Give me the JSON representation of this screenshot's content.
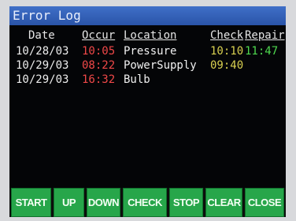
{
  "window": {
    "title": "Error Log"
  },
  "columns": {
    "date": "Date",
    "occur": "Occur",
    "location": "Location",
    "check": "Check",
    "repair": "Repair"
  },
  "rows": [
    {
      "date": "10/28/03",
      "occur": "10:05",
      "location": "Pressure",
      "check": "10:10",
      "repair": "11:47"
    },
    {
      "date": "10/29/03",
      "occur": "08:22",
      "location": "PowerSupply",
      "check": "09:40",
      "repair": ""
    },
    {
      "date": "10/29/03",
      "occur": "16:32",
      "location": "Bulb",
      "check": "",
      "repair": ""
    }
  ],
  "buttons": {
    "start": "START",
    "up": "UP",
    "down": "DOWN",
    "check": "CHECK",
    "stop": "STOP",
    "clear": "CLEAR",
    "close": "CLOSE"
  },
  "colors": {
    "title_bar": "#2f5cb4",
    "occur_time": "#f04848",
    "check_time": "#d8d050",
    "repair_time": "#4ed84e",
    "button": "#27a64a"
  }
}
